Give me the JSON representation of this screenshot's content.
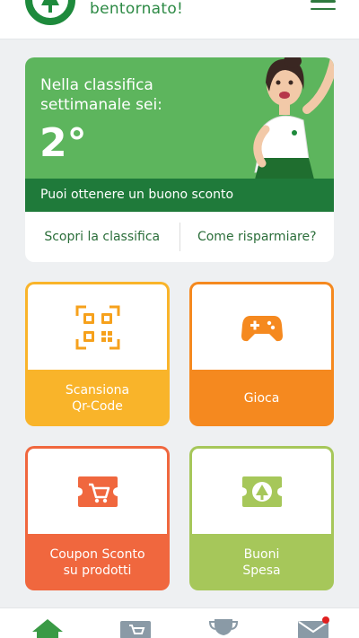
{
  "header": {
    "welcome_text": "bentornato!"
  },
  "ranking": {
    "title": "Nella classifica settimanale sei:",
    "position": "2°",
    "strip_text": "Puoi ottenere un buono sconto",
    "link_ranking": "Scopri la classifica",
    "link_saving": "Come risparmiare?"
  },
  "tiles": [
    {
      "label": "Scansiona\nQr-Code",
      "icon": "qr-code-icon",
      "color": "#f9b42a"
    },
    {
      "label": "Gioca",
      "icon": "gamepad-icon",
      "color": "#f5891f"
    },
    {
      "label": "Coupon Sconto\nsu prodotti",
      "icon": "coupon-cart-icon",
      "color": "#f0673e"
    },
    {
      "label": "Buoni\nSpesa",
      "icon": "voucher-tree-icon",
      "color": "#a6c75a"
    }
  ],
  "bottom_nav": {
    "items": [
      "home-icon",
      "cart-icon",
      "trophy-icon",
      "mail-icon"
    ],
    "active": "home-icon",
    "has_notification": true
  },
  "colors": {
    "brand_green": "#1f7a3a",
    "card_green": "#5db55d",
    "accent_orange": "#f5891f"
  }
}
